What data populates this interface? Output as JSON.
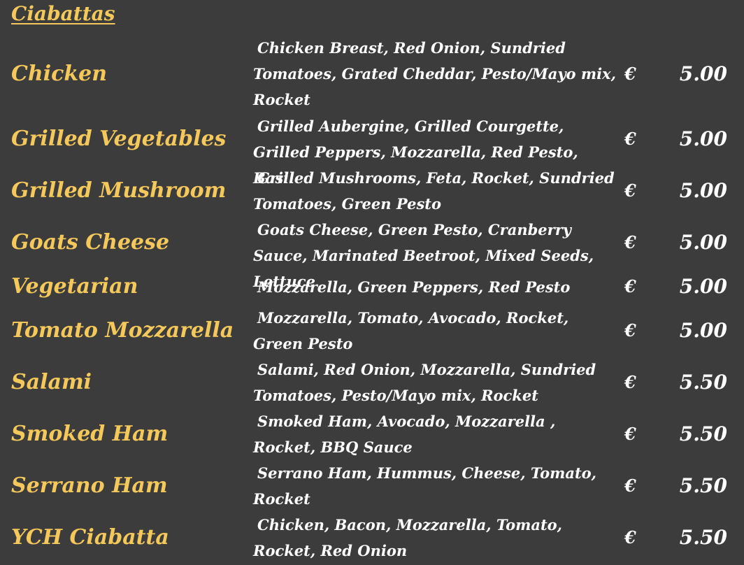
{
  "section_title": "Ciabattas",
  "items": [
    {
      "name": "Chicken",
      "description": "Chicken Breast, Red Onion, Sundried Tomatoes, Grated Cheddar, Pesto/Mayo mix, Rocket",
      "currency": "€",
      "price": "5.00"
    },
    {
      "name": "Grilled Vegetables",
      "description": "Grilled Aubergine, Grilled Courgette, Grilled Peppers, Mozzarella, Red Pesto, Basil",
      "currency": "€",
      "price": "5.00"
    },
    {
      "name": "Grilled Mushroom",
      "description": "Grilled Mushrooms, Feta, Rocket, Sundried Tomatoes, Green Pesto",
      "currency": "€",
      "price": "5.00"
    },
    {
      "name": "Goats Cheese",
      "description": "Goats Cheese, Green Pesto, Cranberry Sauce, Marinated Beetroot, Mixed Seeds, Lettuce",
      "currency": "€",
      "price": "5.00"
    },
    {
      "name": "Vegetarian",
      "description": "Mozzarella, Green Peppers, Red Pesto",
      "currency": "€",
      "price": "5.00"
    },
    {
      "name": "Tomato Mozzarella",
      "description": "Mozzarella, Tomato, Avocado, Rocket, Green Pesto",
      "currency": "€",
      "price": "5.00"
    },
    {
      "name": "Salami",
      "description": "Salami, Red Onion, Mozzarella, Sundried Tomatoes, Pesto/Mayo mix, Rocket",
      "currency": "€",
      "price": "5.50"
    },
    {
      "name": "Smoked Ham",
      "description": "Smoked Ham, Avocado, Mozzarella , Rocket, BBQ Sauce",
      "currency": "€",
      "price": "5.50"
    },
    {
      "name": "Serrano Ham",
      "description": "Serrano Ham, Hummus, Cheese, Tomato, Rocket",
      "currency": "€",
      "price": "5.50"
    },
    {
      "name": "YCH Ciabatta",
      "description": "Chicken, Bacon, Mozzarella, Tomato, Rocket, Red Onion",
      "currency": "€",
      "price": "5.50"
    }
  ],
  "colors": {
    "background": "#3c3c3c",
    "accent": "#f4c85a",
    "text": "#ffffff"
  }
}
